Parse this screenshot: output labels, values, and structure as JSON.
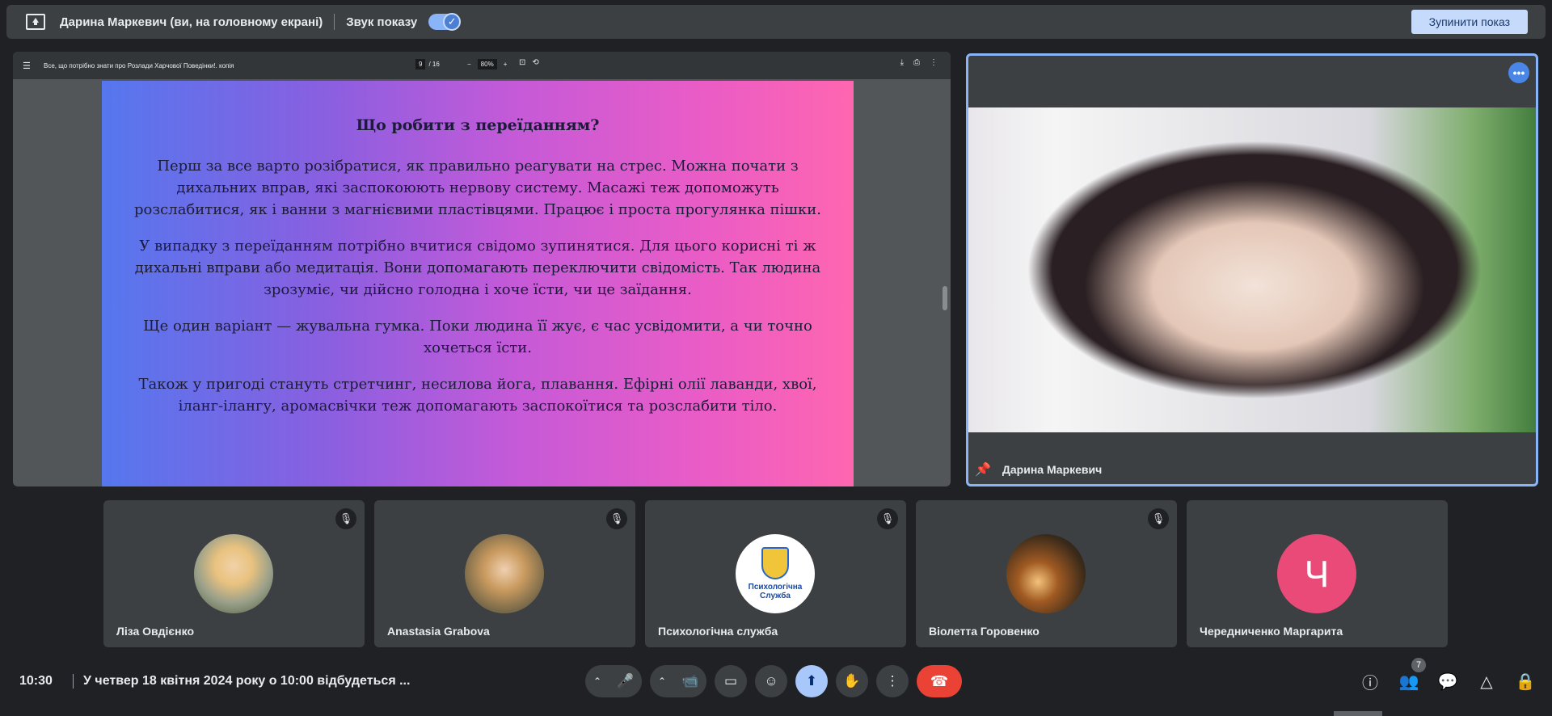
{
  "topbar": {
    "presenter_text": "Дарина Маркевич (ви, на головному екрані)",
    "sound_label": "Звук показу",
    "stop_label": "Зупинити показ"
  },
  "pdf": {
    "doc_title": "Все, що потрібно знати про Розлади Харчової Поведінки!. копія",
    "page_current": "9",
    "page_total": "/ 16",
    "zoom": "80%",
    "zoom_minus": "−",
    "zoom_plus": "+",
    "slide": {
      "title": "Що робити з переїданням?",
      "p1": "Перш за все варто розібратися, як правильно реагувати на стрес. Можна почати з дихальних вправ, які заспокоюють нервову систему. Масажі теж допоможуть розслабитися, як і ванни з магнієвими пластівцями. Працює і проста прогулянка пішки.",
      "p2": "У випадку з переїданням потрібно вчитися свідомо зупинятися. Для цього корисні ті ж дихальні вправи або медитація. Вони допомагають переключити свідомість. Так людина зрозуміє, чи дійсно голодна і хоче їсти, чи це заїдання.",
      "p3": "Ще один варіант — жувальна гумка. Поки людина її жує, є час усвідомити, а чи точно хочеться їсти.",
      "p4": "Також у пригоді стануть стретчинг, несилова йога, плавання. Ефірні олії лаванди, хвої, іланг-ілангу, аромасвічки теж допомагають заспокоїтися та розслабити тіло."
    }
  },
  "speaker": {
    "name": "Дарина Маркевич",
    "more_glyph": "•••"
  },
  "participants": [
    {
      "name": "Ліза Овдієнко",
      "muted": true
    },
    {
      "name": "Anastasia Grabova",
      "muted": true
    },
    {
      "name": "Психологічна служба",
      "muted": true,
      "avatar_text": "Психологічна Служба"
    },
    {
      "name": "Віолетта Горовенко",
      "muted": true
    },
    {
      "name": "Чередниченко Маргарита",
      "muted": false,
      "initial": "Ч"
    }
  ],
  "bottom": {
    "time": "10:30",
    "meeting_title": "У четвер 18 квітня 2024 року о 10:00 відбудеться ...",
    "participants_count": "7"
  },
  "colors": {
    "accent": "#8ab4f8",
    "end_call": "#ea4335",
    "avatar_initial_bg": "#ea4a78"
  },
  "icons": {
    "present": "present-to-all-icon",
    "mic": "mic-icon",
    "camera": "videocam-icon",
    "captions": "closed-caption-icon",
    "emoji": "emoji-icon",
    "share": "present-screen-icon",
    "hand": "raise-hand-icon",
    "more": "more-vert-icon",
    "end": "call-end-icon",
    "info": "info-icon",
    "people": "people-icon",
    "chat": "chat-icon",
    "activities": "activities-icon",
    "lock": "host-controls-icon"
  }
}
